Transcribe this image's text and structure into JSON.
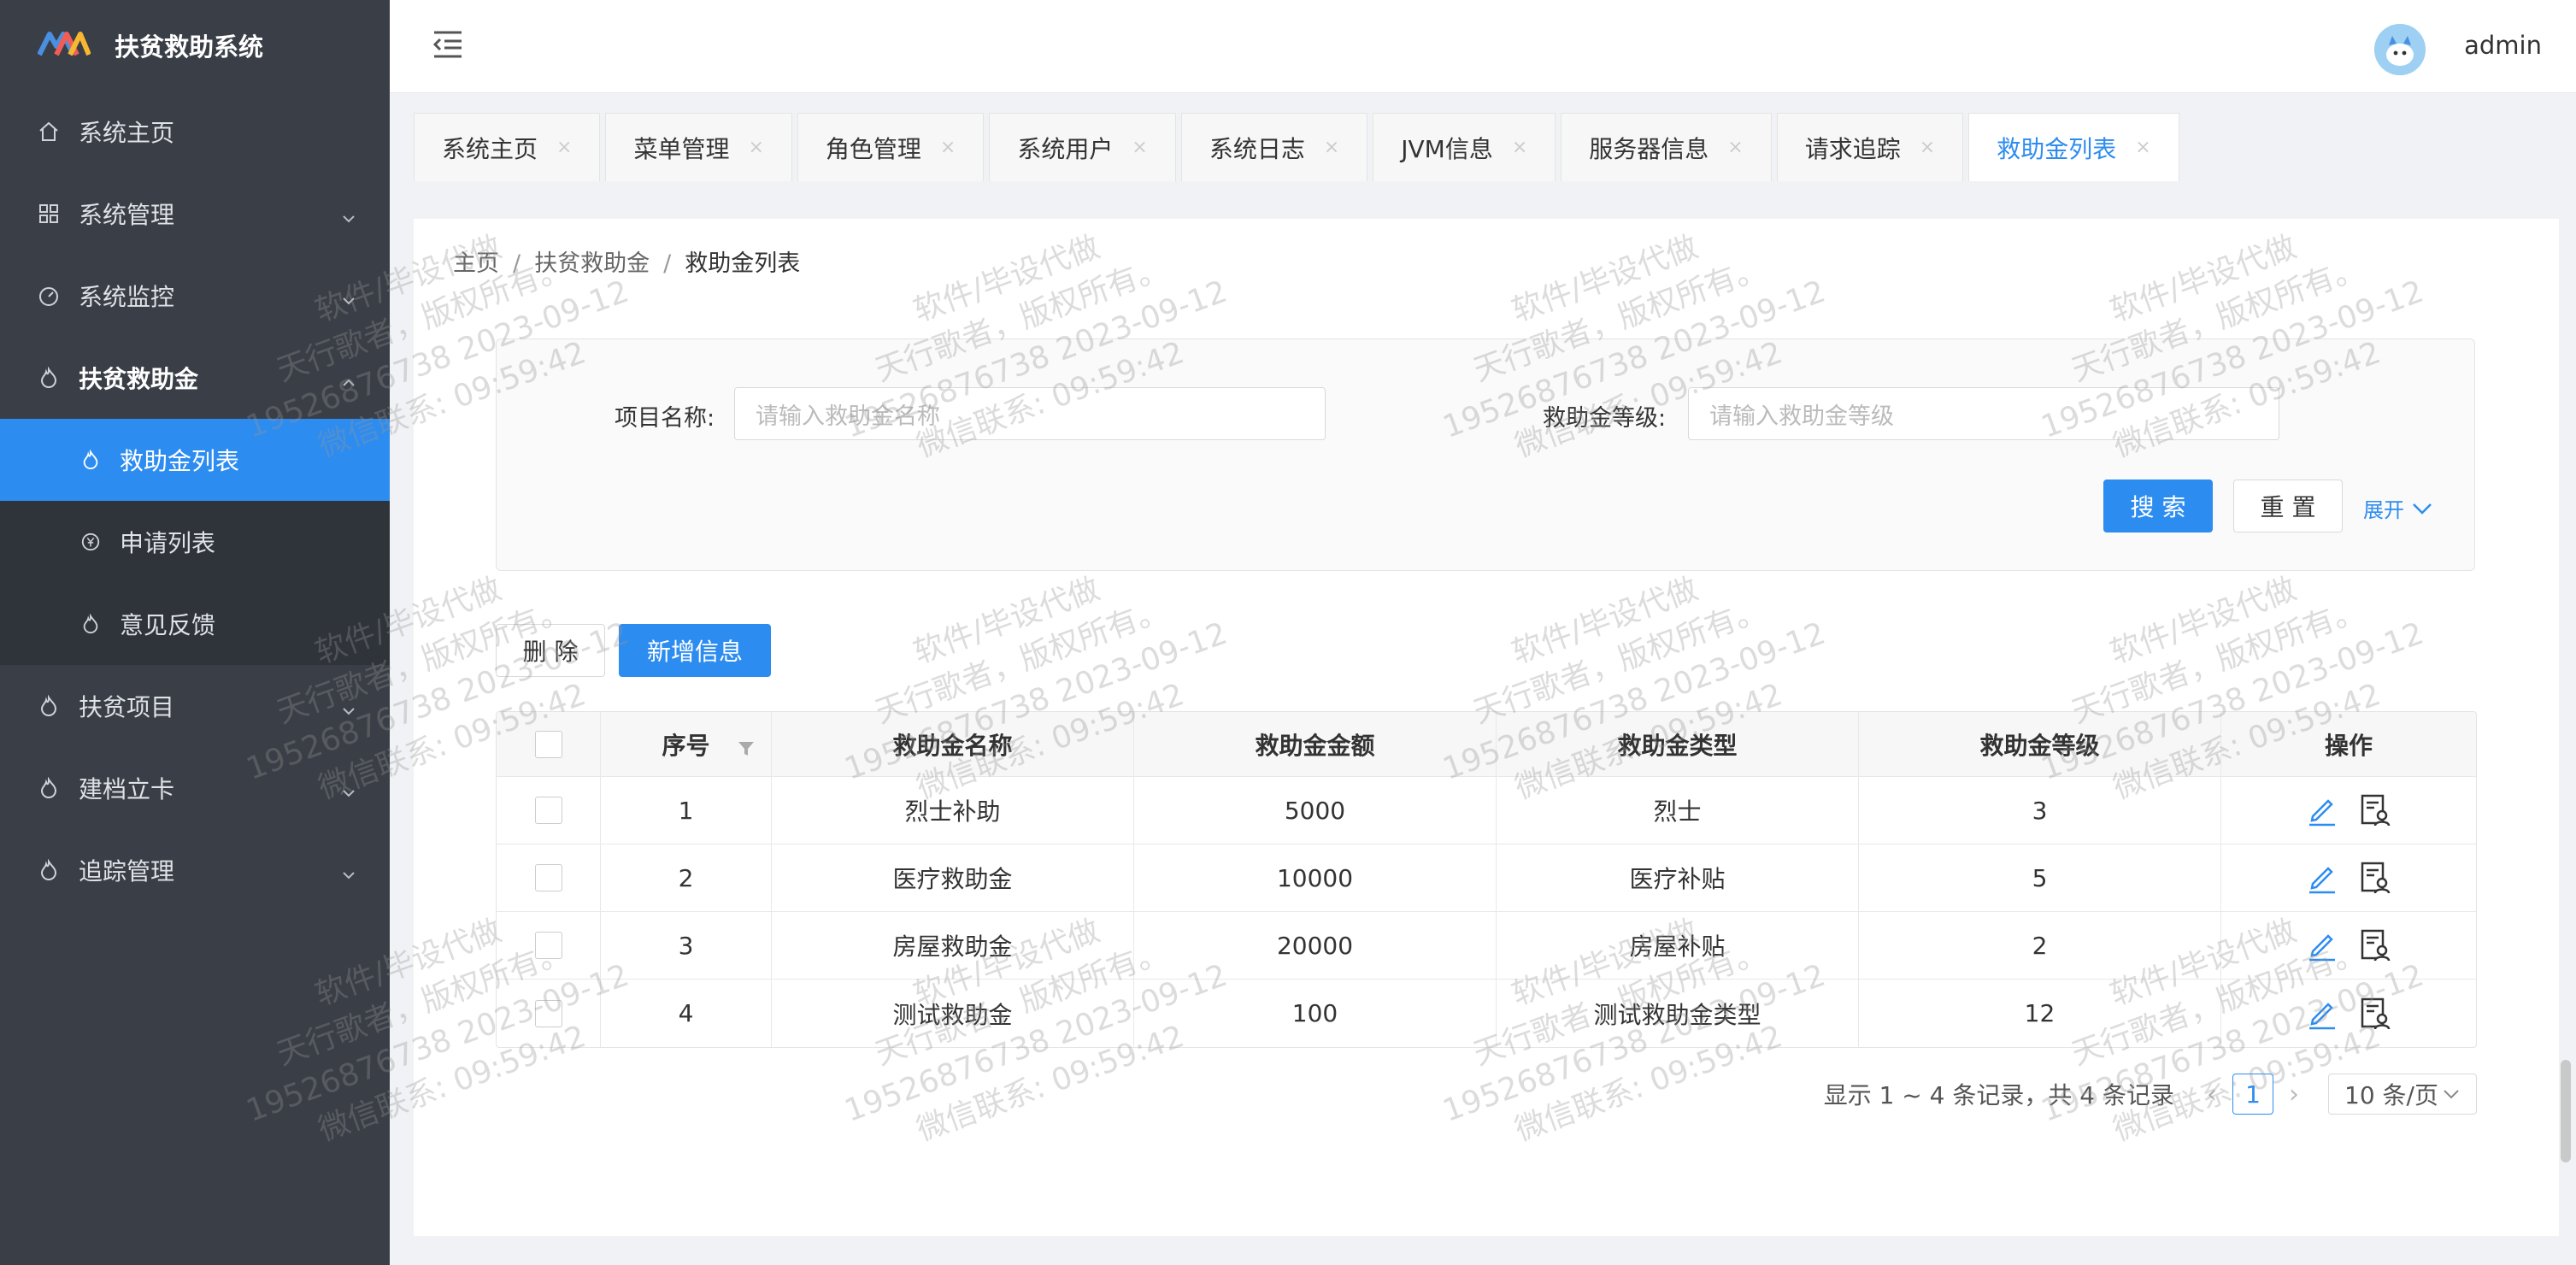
{
  "app": {
    "title": "扶贫救助系统"
  },
  "sidebar": {
    "items": [
      {
        "label": "系统主页",
        "icon": "home-icon"
      },
      {
        "label": "系统管理",
        "icon": "grid-icon"
      },
      {
        "label": "系统监控",
        "icon": "dashboard-icon"
      },
      {
        "label": "扶贫救助金",
        "icon": "flame-icon"
      },
      {
        "label": "扶贫项目",
        "icon": "flame-icon"
      },
      {
        "label": "建档立卡",
        "icon": "flame-icon"
      },
      {
        "label": "追踪管理",
        "icon": "flame-icon"
      }
    ],
    "sub_items": [
      {
        "label": "救助金列表",
        "icon": "flame-icon"
      },
      {
        "label": "申请列表",
        "icon": "yen-icon"
      },
      {
        "label": "意见反馈",
        "icon": "flame-icon"
      }
    ]
  },
  "header": {
    "user": "admin"
  },
  "tabs": [
    "系统主页",
    "菜单管理",
    "角色管理",
    "系统用户",
    "系统日志",
    "JVM信息",
    "服务器信息",
    "请求追踪",
    "救助金列表"
  ],
  "breadcrumb": [
    "主页",
    "扶贫救助金",
    "救助金列表"
  ],
  "search": {
    "name_label": "项目名称:",
    "name_placeholder": "请输入救助金名称",
    "level_label": "救助金等级:",
    "level_placeholder": "请输入救助金等级",
    "search_btn": "搜 索",
    "reset_btn": "重 置",
    "expand": "展开"
  },
  "actions": {
    "delete": "删 除",
    "add": "新增信息"
  },
  "table": {
    "headers": [
      "序号",
      "救助金名称",
      "救助金金额",
      "救助金类型",
      "救助金等级",
      "操作"
    ],
    "rows": [
      [
        "1",
        "烈士补助",
        "5000",
        "烈士",
        "3"
      ],
      [
        "2",
        "医疗救助金",
        "10000",
        "医疗补贴",
        "5"
      ],
      [
        "3",
        "房屋救助金",
        "20000",
        "房屋补贴",
        "2"
      ],
      [
        "4",
        "测试救助金",
        "100",
        "测试救助金类型",
        "12"
      ]
    ]
  },
  "pagination": {
    "summary": "显示 1 ~ 4 条记录，共 4 条记录",
    "current": "1",
    "page_size": "10 条/页"
  },
  "watermark": {
    "line1": "软件/毕设代做",
    "line2": "天行歌者，版权所有。",
    "line3": "19526876738 2023-09-12",
    "line4": "微信联系:",
    "line5": "09:59:42"
  },
  "colors": {
    "accent": "#2d8cf0",
    "sidebar_bg": "#3a3f47"
  }
}
